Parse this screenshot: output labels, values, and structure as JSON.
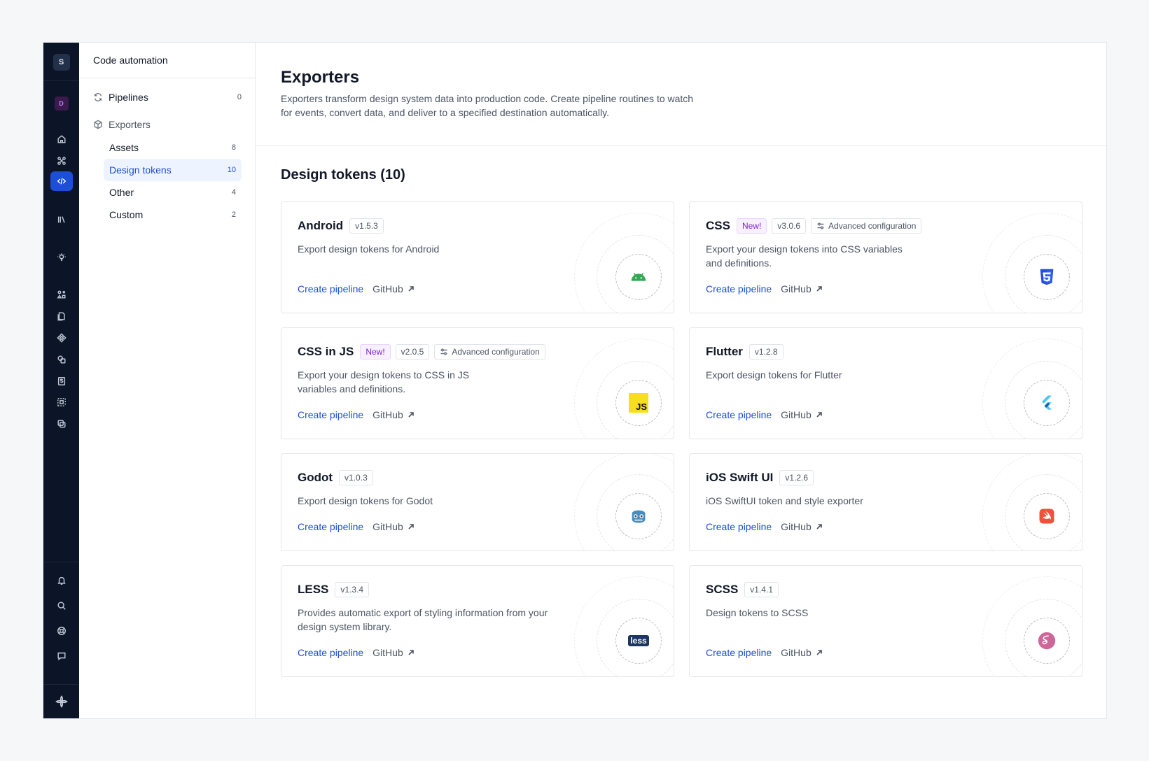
{
  "rail": {
    "workspace_initial": "S",
    "design_system_initial": "D"
  },
  "sidebar": {
    "title": "Code automation",
    "pipelines": {
      "label": "Pipelines",
      "count": "0"
    },
    "exporters": {
      "label": "Exporters"
    },
    "items": [
      {
        "label": "Assets",
        "count": "8"
      },
      {
        "label": "Design tokens",
        "count": "10"
      },
      {
        "label": "Other",
        "count": "4"
      },
      {
        "label": "Custom",
        "count": "2"
      }
    ]
  },
  "header": {
    "title": "Exporters",
    "description": "Exporters transform design system data into production code. Create pipeline routines to watch for events, convert data, and deliver to a specified destination automatically."
  },
  "section": {
    "title": "Design tokens (10)"
  },
  "cards": [
    {
      "name": "Android",
      "version": "v1.5.3",
      "description": "Export design tokens for Android",
      "create": "Create pipeline",
      "github": "GitHub",
      "icon": "android-icon"
    },
    {
      "name": "CSS",
      "new_badge": "New!",
      "version": "v3.0.6",
      "advanced": "Advanced configuration",
      "description": "Export your design tokens into CSS variables and definitions.",
      "create": "Create pipeline",
      "github": "GitHub",
      "icon": "css3-icon"
    },
    {
      "name": "CSS in JS",
      "new_badge": "New!",
      "version": "v2.0.5",
      "advanced": "Advanced configuration",
      "description": "Export your design tokens to CSS in JS variables and definitions.",
      "create": "Create pipeline",
      "github": "GitHub",
      "icon": "js-icon",
      "icon_text": "JS"
    },
    {
      "name": "Flutter",
      "version": "v1.2.8",
      "description": "Export design tokens for Flutter",
      "create": "Create pipeline",
      "github": "GitHub",
      "icon": "flutter-icon"
    },
    {
      "name": "Godot",
      "version": "v1.0.3",
      "description": "Export design tokens for Godot",
      "create": "Create pipeline",
      "github": "GitHub",
      "icon": "godot-icon"
    },
    {
      "name": "iOS Swift UI",
      "version": "v1.2.6",
      "description": "iOS SwiftUI token and style exporter",
      "create": "Create pipeline",
      "github": "GitHub",
      "icon": "swift-icon"
    },
    {
      "name": "LESS",
      "version": "v1.3.4",
      "description": "Provides automatic export of styling information from your design system library.",
      "create": "Create pipeline",
      "github": "GitHub",
      "icon": "less-icon",
      "icon_text": "less"
    },
    {
      "name": "SCSS",
      "version": "v1.4.1",
      "description": "Design tokens to SCSS",
      "create": "Create pipeline",
      "github": "GitHub",
      "icon": "sass-icon"
    }
  ],
  "colors": {
    "accent": "#1d4ed8",
    "rail_bg": "#0c1527",
    "selected_bg": "#eef4ff",
    "new_badge": "#7e22ce"
  }
}
